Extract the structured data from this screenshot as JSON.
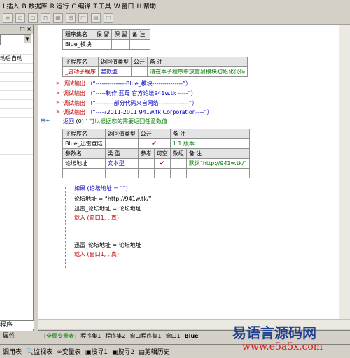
{
  "menu": {
    "items": [
      "I.插入",
      "B.数据库",
      "R.运行",
      "C.编译",
      "T.工具",
      "W.窗口",
      "H.帮助"
    ]
  },
  "left_panel": {
    "head": "□ ×",
    "row_text": "动后自动",
    "bottom_label": "程序",
    "tab_label": "属性"
  },
  "assembly_table": {
    "headers": [
      "程序集名",
      "保 留",
      "保 留",
      "备 注"
    ],
    "row": [
      "Blue_模块",
      "",
      "",
      ""
    ]
  },
  "sub1_table": {
    "headers": [
      "子程序名",
      "返回值类型",
      "公开",
      "备 注"
    ],
    "row": [
      "_启动子程序",
      "整数型",
      "",
      "请在本子程序中放置易模块初始化代码"
    ]
  },
  "code_lines": [
    {
      "fn": "调试输出",
      "arg": "（“---------------Blue_模块---------------”）"
    },
    {
      "fn": "调试输出",
      "arg": "（“-----制作 蓝莓  官方论坛941w.tk -----”）"
    },
    {
      "fn": "调试输出",
      "arg": "（“---------部分代码来自网络---------------”）"
    },
    {
      "fn": "调试输出",
      "arg": "（“----?2011-2011 941w.tk Corporation----”）"
    }
  ],
  "return_line": {
    "kw": "返回",
    "arg": "(0)",
    "comment": "' 可以根据您的需要返回任意数值"
  },
  "sub2_table": {
    "headers": [
      "子程序名",
      "返回值类型",
      "公开",
      "备 注"
    ],
    "row": [
      "Blue_迅雷登陆",
      "",
      "✔",
      "1.1 版本"
    ],
    "param_headers": [
      "参数名",
      "类 型",
      "参考",
      "可空",
      "数组",
      "备 注"
    ],
    "param_row": [
      "论坛地址",
      "文本型",
      "",
      "✔",
      "",
      "默认“http://941w.tk/”"
    ]
  },
  "code2": {
    "if_line": "如果 (论坛地址 = “”)",
    "assign1": "论坛地址 = “http://941w.tk/”",
    "assign2": "迅雷_论坛地址 = 论坛地址",
    "load1": "载入 (窗口1, , 真)",
    "assign3": "迅雷_论坛地址 = 论坛地址",
    "load2": "载入 (窗口1, , 真)"
  },
  "tabs": [
    "[全局变量表]",
    "程序集1",
    "程序集2",
    "窗口程序集1",
    "窗口1",
    "Blue"
  ],
  "bottom_tabs": [
    "调用表",
    "监视表",
    "变量表",
    "搜寻1",
    "搜寻2",
    "剪辑历史"
  ],
  "watermark": {
    "title": "易语言源码网",
    "url": "www.e5a5x.com"
  }
}
